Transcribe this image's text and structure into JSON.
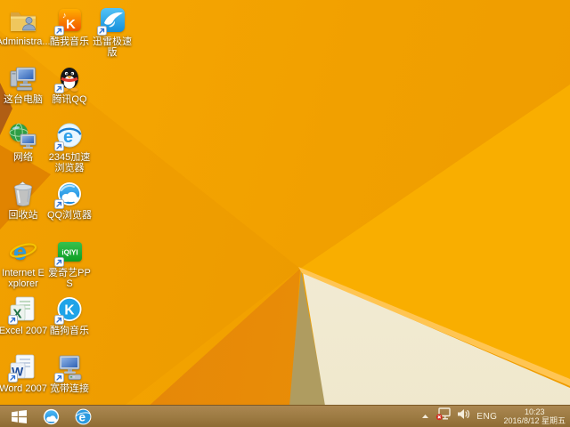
{
  "desktop": {
    "icons": [
      {
        "label": "Administra...",
        "name": "administrator-folder"
      },
      {
        "label": "酷我音乐",
        "name": "kuwo-music"
      },
      {
        "label": "迅雷极速版",
        "name": "xunlei-speed"
      },
      {
        "label": "这台电脑",
        "name": "this-pc"
      },
      {
        "label": "腾讯QQ",
        "name": "tencent-qq"
      },
      {
        "label": "网络",
        "name": "network"
      },
      {
        "label": "2345加速浏览器",
        "name": "2345-browser"
      },
      {
        "label": "回收站",
        "name": "recycle-bin"
      },
      {
        "label": "QQ浏览器",
        "name": "qq-browser"
      },
      {
        "label": "Internet Explorer",
        "name": "internet-explorer"
      },
      {
        "label": "爱奇艺PPS",
        "name": "iqiyi-pps"
      },
      {
        "label": "Excel 2007",
        "name": "excel-2007"
      },
      {
        "label": "酷狗音乐",
        "name": "kugou-music"
      },
      {
        "label": "Word 2007",
        "name": "word-2007"
      },
      {
        "label": "宽带连接",
        "name": "broadband-connection"
      }
    ]
  },
  "iqiyi_logo_text": "iQIYI",
  "taskbar": {
    "buttons": [
      "start",
      "qq-browser",
      "internet-explorer"
    ],
    "tray": {
      "language": "ENG",
      "time": "10:23",
      "date": "2016/8/12 星期五"
    }
  },
  "colors": {
    "wallpaper_orange": "#F1A000",
    "wallpaper_bright_yellow": "#F9AE00",
    "wallpaper_cream": "#F3EDD9",
    "wallpaper_khaki": "#AF9C60",
    "taskbar_brown": "#9C7A42",
    "kuwo_orange": "#F25600",
    "xunlei_blue": "#22A7EE",
    "qq_scarf_red": "#E03A2F",
    "iqiyi_green": "#12B02C",
    "kugou_blue": "#1FA3E8",
    "excel_green": "#1E7145",
    "word_blue": "#1F4E9C",
    "ie_blue": "#2C9BE0",
    "network_error_red": "#D42B1E"
  }
}
